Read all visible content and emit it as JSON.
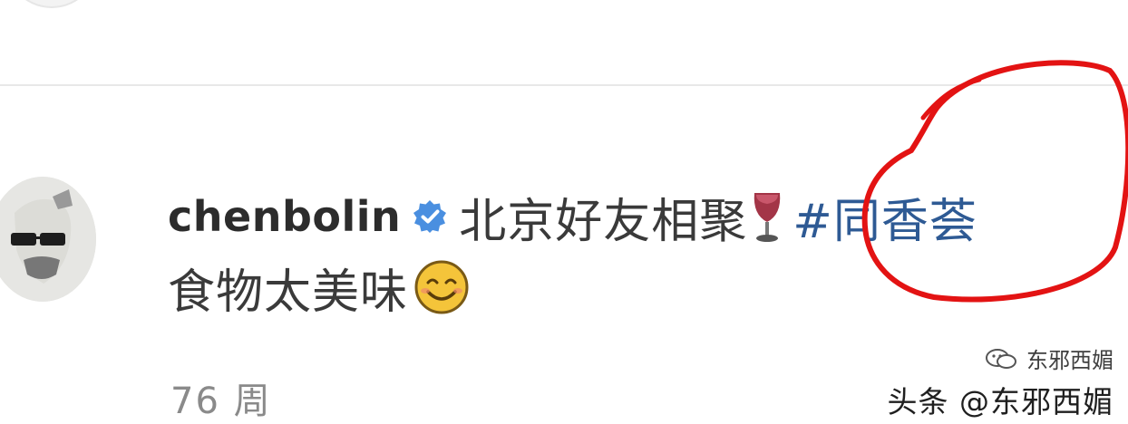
{
  "comment": {
    "username": "chenbolin",
    "caption": "北京好友相聚",
    "hashtag": "#同香荟",
    "caption_line2": "食物太美味",
    "meta": "76 周"
  },
  "watermark": {
    "top": "东邪西媚",
    "bottom": "头条 @东邪西媚"
  },
  "colors": {
    "verified": "#4a8fe0",
    "hashtag": "#2e5a94",
    "annotation": "#e31313"
  },
  "icons": {
    "badge": "verified-badge-icon",
    "wine": "wine-glass-icon",
    "emoji": "smiling-face-icon",
    "wechat": "wechat-icon"
  }
}
